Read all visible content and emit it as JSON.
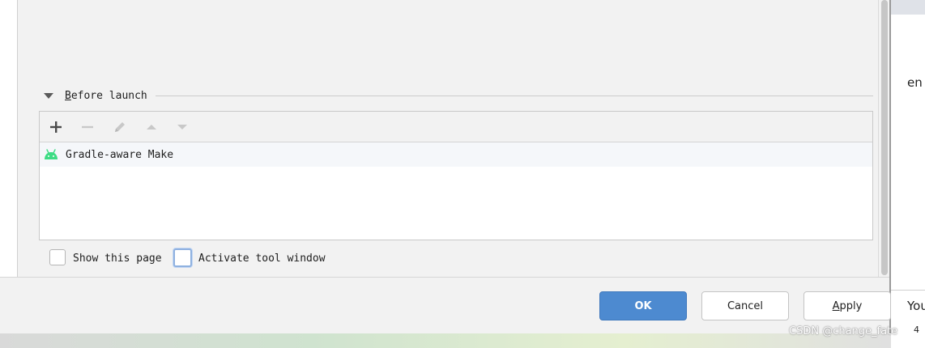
{
  "section": {
    "title_mnemonic": "B",
    "title_rest": "efore launch"
  },
  "toolbar": {
    "add_icon": "plus-icon",
    "remove_icon": "minus-icon",
    "edit_icon": "pencil-icon",
    "move_up_icon": "arrow-up-icon",
    "move_down_icon": "arrow-down-icon"
  },
  "tasks": [
    {
      "icon": "android-icon",
      "label": "Gradle-aware Make"
    }
  ],
  "options": {
    "show_page_label": "Show this page",
    "activate_tool_window_label": "Activate tool window"
  },
  "buttons": {
    "ok": "OK",
    "cancel": "Cancel",
    "apply_mnemonic": "A",
    "apply_rest": "pply"
  },
  "background_fragments": {
    "right_top": "en",
    "right_bottom": "You",
    "right_corner": "4"
  },
  "watermark": "CSDN @change_fate",
  "colors": {
    "accent": "#4d8ad0",
    "android_green": "#3ddc84",
    "panel_bg": "#f2f2f2"
  }
}
